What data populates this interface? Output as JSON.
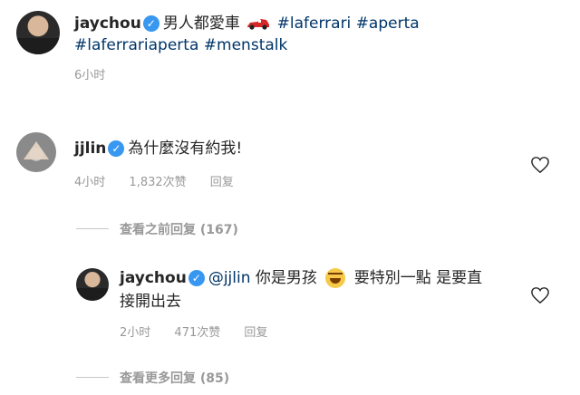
{
  "post": {
    "username": "jaychou",
    "text_before": "男人都愛車",
    "car_icon": "race-car-icon",
    "hashtag1": "#laferrari",
    "hashtag2": "#aperta",
    "hashtag3": "#laferrariaperta",
    "hashtag4": "#menstalk",
    "time": "6小时"
  },
  "comment1": {
    "username": "jjlin",
    "text": "為什麼沒有約我!",
    "time": "4小时",
    "likes": "1,832次赞",
    "reply": "回复"
  },
  "view_previous": "查看之前回复 (167)",
  "reply1": {
    "username": "jaychou",
    "mention": "@jjlin",
    "text_a": "你是男孩",
    "emoji": "face-with-tears-of-joy",
    "text_b": "要特別一點 是要直",
    "text_c": "接開出去",
    "time": "2小时",
    "likes": "471次赞",
    "reply": "回复"
  },
  "view_more": "查看更多回复 (85)",
  "colors": {
    "verified": "#3897f0",
    "hashtag": "#003569",
    "meta": "#999999"
  }
}
